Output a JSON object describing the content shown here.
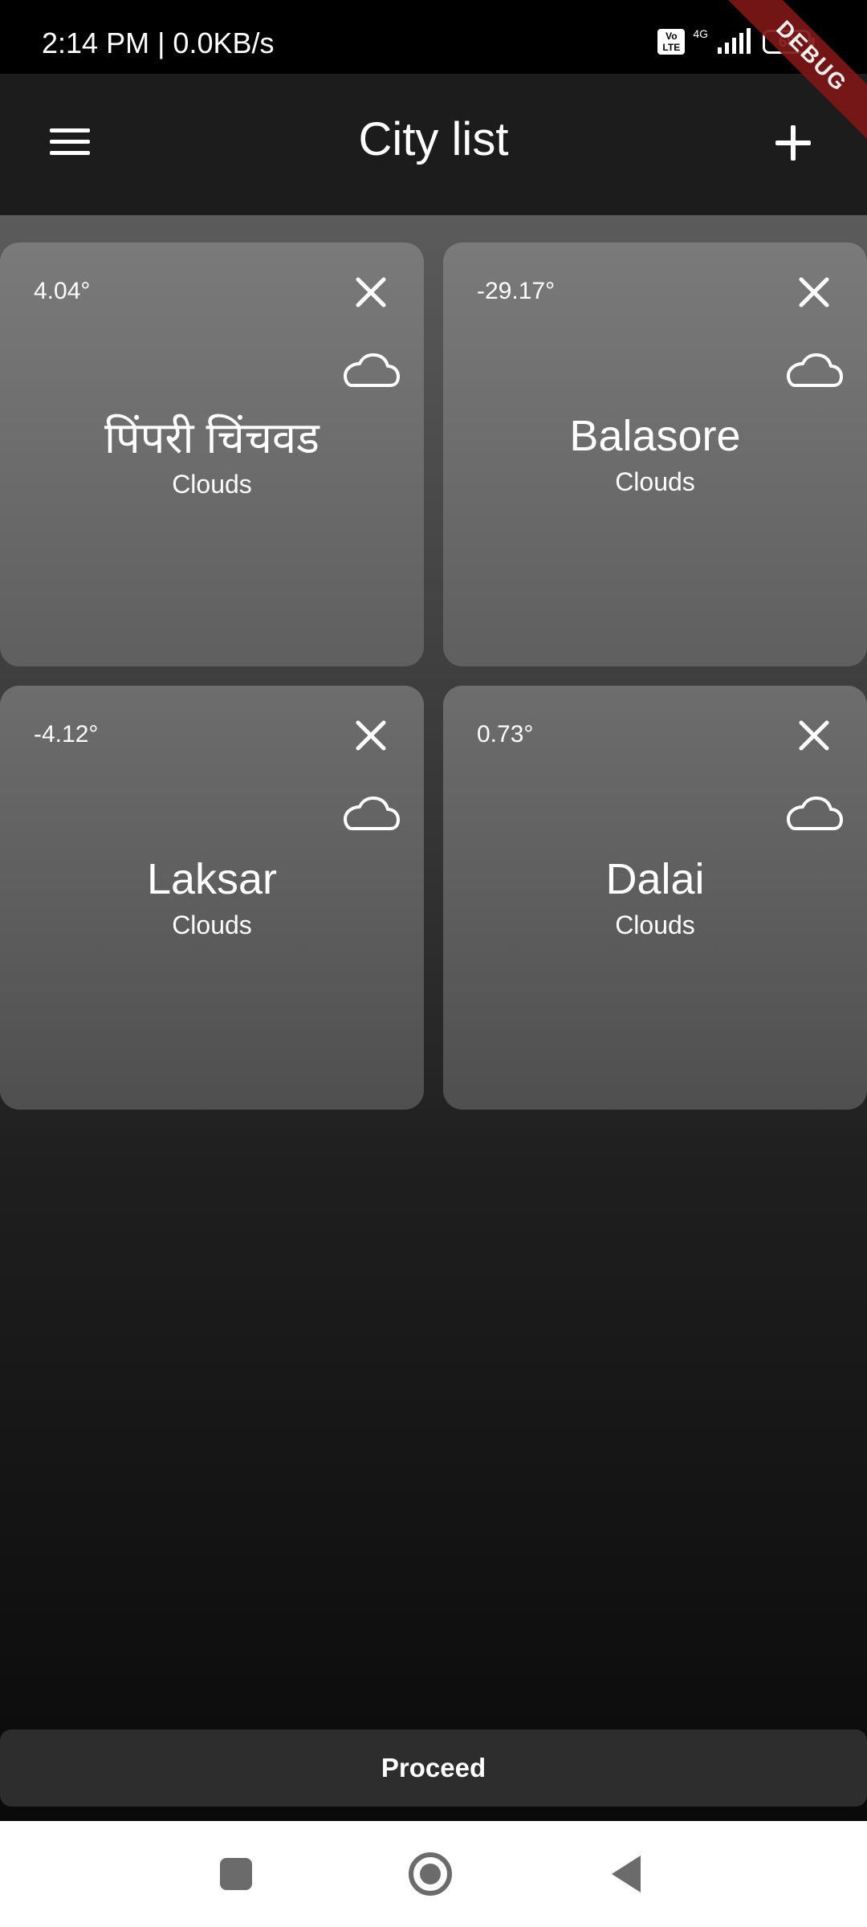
{
  "status_bar": {
    "time_speed": "2:14 PM | 0.0KB/s",
    "volte_label": "Vo LTE",
    "network_label": "4G",
    "battery_level": "68",
    "debug_label": "DEBUG"
  },
  "app_bar": {
    "title": "City list",
    "menu_icon": "menu-icon",
    "add_icon": "plus-icon"
  },
  "cities": [
    {
      "temperature": "4.04°",
      "name": "पिंपरी चिंचवड",
      "condition": "Clouds",
      "close_icon": "close-icon",
      "weather_icon": "cloud-icon"
    },
    {
      "temperature": "-29.17°",
      "name": "Balasore",
      "condition": "Clouds",
      "close_icon": "close-icon",
      "weather_icon": "cloud-icon"
    },
    {
      "temperature": "-4.12°",
      "name": "Laksar",
      "condition": "Clouds",
      "close_icon": "close-icon",
      "weather_icon": "cloud-icon"
    },
    {
      "temperature": "0.73°",
      "name": "Dalai",
      "condition": "Clouds",
      "close_icon": "close-icon",
      "weather_icon": "cloud-icon"
    }
  ],
  "actions": {
    "proceed_label": "Proceed"
  },
  "navigation": {
    "recents_icon": "square-icon",
    "home_icon": "circle-icon",
    "back_icon": "triangle-back-icon"
  },
  "colors": {
    "debug_ribbon": "#7e1717",
    "card_start": "#7a7a7a",
    "card_end": "#5f5f5f",
    "nav_bar_background": "#ffffff",
    "nav_icon": "#6b6b6b"
  }
}
